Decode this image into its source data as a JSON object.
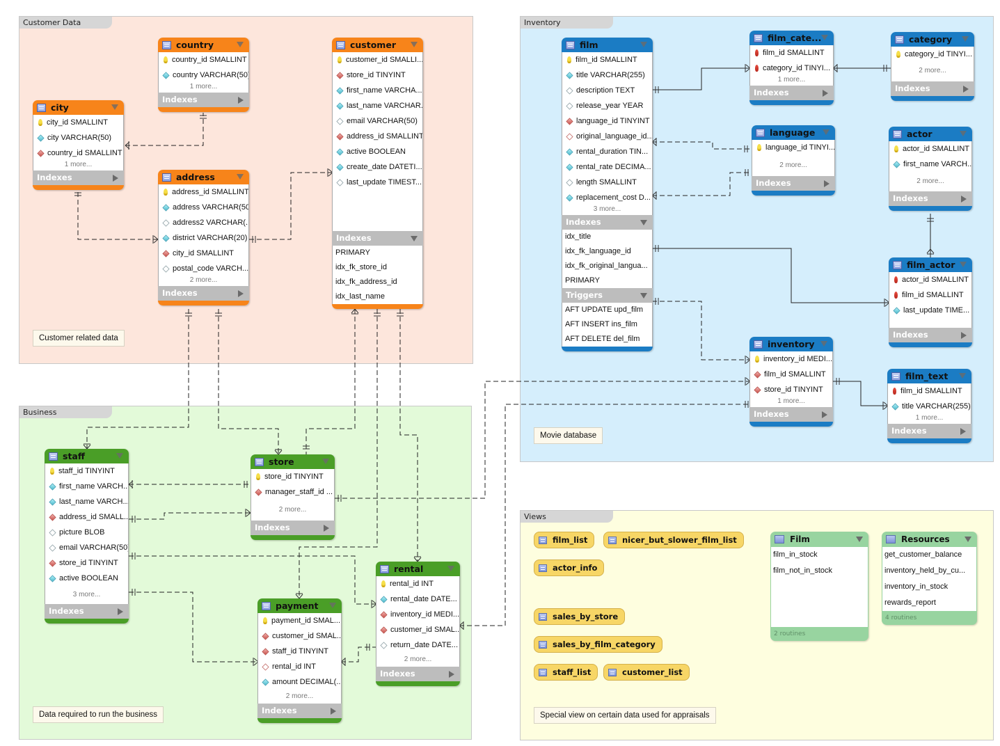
{
  "layers": {
    "customer_data": {
      "title": "Customer Data",
      "color": "#fde6dc",
      "note": "Customer related data"
    },
    "business": {
      "title": "Business",
      "color": "#e3fad9",
      "note": "Data required to run the business"
    },
    "inventory": {
      "title": "Inventory",
      "color": "#d5eefc",
      "note": "Movie database"
    },
    "views": {
      "title": "Views",
      "color": "#fefedf",
      "note": "Special view on certain data used for appraisals"
    }
  },
  "colors": {
    "customer_header": "#f7841a",
    "inventory_header": "#1b7cc4",
    "business_header": "#4a9e27",
    "view_chip": "#f7d666",
    "routine_group": "#98d4a0"
  },
  "section_labels": {
    "indexes": "Indexes",
    "triggers": "Triggers"
  },
  "tables": {
    "country": {
      "name": "country",
      "columns": [
        {
          "icon": "pk",
          "text": "country_id SMALLINT"
        },
        {
          "icon": "nn",
          "text": "country VARCHAR(50)"
        }
      ],
      "more": "1 more..."
    },
    "city": {
      "name": "city",
      "columns": [
        {
          "icon": "pk",
          "text": "city_id SMALLINT"
        },
        {
          "icon": "nn",
          "text": "city VARCHAR(50)"
        },
        {
          "icon": "fk",
          "text": "country_id SMALLINT"
        }
      ],
      "more": "1 more..."
    },
    "address": {
      "name": "address",
      "columns": [
        {
          "icon": "pk",
          "text": "address_id SMALLINT"
        },
        {
          "icon": "nn",
          "text": "address VARCHAR(50)"
        },
        {
          "icon": "plain",
          "text": "address2 VARCHAR(..."
        },
        {
          "icon": "nn",
          "text": "district VARCHAR(20)"
        },
        {
          "icon": "fk",
          "text": "city_id SMALLINT"
        },
        {
          "icon": "plain",
          "text": "postal_code VARCH..."
        }
      ],
      "more": "2 more..."
    },
    "customer": {
      "name": "customer",
      "columns": [
        {
          "icon": "pk",
          "text": "customer_id SMALLI..."
        },
        {
          "icon": "fk",
          "text": "store_id TINYINT"
        },
        {
          "icon": "nn",
          "text": "first_name VARCHA..."
        },
        {
          "icon": "nn",
          "text": "last_name VARCHAR..."
        },
        {
          "icon": "plain",
          "text": "email VARCHAR(50)"
        },
        {
          "icon": "fk",
          "text": "address_id SMALLINT"
        },
        {
          "icon": "nn",
          "text": "active BOOLEAN"
        },
        {
          "icon": "nn",
          "text": "create_date DATETI..."
        },
        {
          "icon": "plain",
          "text": "last_update TIMEST..."
        }
      ],
      "indexes": [
        "PRIMARY",
        "idx_fk_store_id",
        "idx_fk_address_id",
        "idx_last_name"
      ]
    },
    "film": {
      "name": "film",
      "columns": [
        {
          "icon": "pk",
          "text": "film_id SMALLINT"
        },
        {
          "icon": "nn",
          "text": "title VARCHAR(255)"
        },
        {
          "icon": "plain",
          "text": "description TEXT"
        },
        {
          "icon": "plain",
          "text": "release_year YEAR"
        },
        {
          "icon": "fk",
          "text": "language_id TINYINT"
        },
        {
          "icon": "fkplain",
          "text": "original_language_id..."
        },
        {
          "icon": "nn",
          "text": "rental_duration TIN..."
        },
        {
          "icon": "nn",
          "text": "rental_rate DECIMA..."
        },
        {
          "icon": "plain",
          "text": "length SMALLINT"
        },
        {
          "icon": "nn",
          "text": "replacement_cost D..."
        }
      ],
      "more": "3 more...",
      "indexes": [
        "idx_title",
        "idx_fk_language_id",
        "idx_fk_original_langua...",
        "PRIMARY"
      ],
      "triggers": [
        "AFT UPDATE upd_film",
        "AFT INSERT ins_film",
        "AFT DELETE del_film"
      ]
    },
    "film_category": {
      "name": "film_cate...",
      "columns": [
        {
          "icon": "pkfk",
          "text": "film_id SMALLINT"
        },
        {
          "icon": "pkfk",
          "text": "category_id TINYI..."
        }
      ],
      "more": "1 more..."
    },
    "category": {
      "name": "category",
      "columns": [
        {
          "icon": "pk",
          "text": "category_id TINYI..."
        }
      ],
      "more": "2 more..."
    },
    "language": {
      "name": "language",
      "columns": [
        {
          "icon": "pk",
          "text": "language_id TINYI..."
        }
      ],
      "more": "2 more..."
    },
    "actor": {
      "name": "actor",
      "columns": [
        {
          "icon": "pk",
          "text": "actor_id SMALLINT"
        },
        {
          "icon": "nn",
          "text": "first_name VARCH..."
        }
      ],
      "more": "2 more..."
    },
    "film_actor": {
      "name": "film_actor",
      "columns": [
        {
          "icon": "pkfk",
          "text": "actor_id SMALLINT"
        },
        {
          "icon": "pkfk",
          "text": "film_id SMALLINT"
        },
        {
          "icon": "nn",
          "text": "last_update TIME..."
        }
      ]
    },
    "inventory": {
      "name": "inventory",
      "columns": [
        {
          "icon": "pk",
          "text": "inventory_id MEDI..."
        },
        {
          "icon": "fk",
          "text": "film_id SMALLINT"
        },
        {
          "icon": "fk",
          "text": "store_id TINYINT"
        }
      ],
      "more": "1 more..."
    },
    "film_text": {
      "name": "film_text",
      "columns": [
        {
          "icon": "pkfk",
          "text": "film_id SMALLINT"
        },
        {
          "icon": "nn",
          "text": "title VARCHAR(255)"
        }
      ],
      "more": "1 more..."
    },
    "staff": {
      "name": "staff",
      "columns": [
        {
          "icon": "pk",
          "text": "staff_id TINYINT"
        },
        {
          "icon": "nn",
          "text": "first_name VARCH..."
        },
        {
          "icon": "nn",
          "text": "last_name VARCH..."
        },
        {
          "icon": "fk",
          "text": "address_id SMALL..."
        },
        {
          "icon": "plain",
          "text": "picture BLOB"
        },
        {
          "icon": "plain",
          "text": "email VARCHAR(50)"
        },
        {
          "icon": "fk",
          "text": "store_id TINYINT"
        },
        {
          "icon": "nn",
          "text": "active BOOLEAN"
        }
      ],
      "more": "3 more..."
    },
    "store": {
      "name": "store",
      "columns": [
        {
          "icon": "pk",
          "text": "store_id TINYINT"
        },
        {
          "icon": "fk",
          "text": "manager_staff_id ..."
        }
      ],
      "more": "2 more..."
    },
    "payment": {
      "name": "payment",
      "columns": [
        {
          "icon": "pk",
          "text": "payment_id SMAL..."
        },
        {
          "icon": "fk",
          "text": "customer_id SMAL..."
        },
        {
          "icon": "fk",
          "text": "staff_id TINYINT"
        },
        {
          "icon": "fkplain",
          "text": "rental_id INT"
        },
        {
          "icon": "nn",
          "text": "amount DECIMAL(..."
        }
      ],
      "more": "2 more..."
    },
    "rental": {
      "name": "rental",
      "columns": [
        {
          "icon": "pk",
          "text": "rental_id INT"
        },
        {
          "icon": "nn",
          "text": "rental_date DATE..."
        },
        {
          "icon": "fk",
          "text": "inventory_id MEDI..."
        },
        {
          "icon": "fk",
          "text": "customer_id SMAL..."
        },
        {
          "icon": "plain",
          "text": "return_date DATE..."
        }
      ],
      "more": "2 more..."
    }
  },
  "views": [
    "film_list",
    "nicer_but_slower_film_list",
    "actor_info",
    "sales_by_store",
    "sales_by_film_category",
    "staff_list",
    "customer_list"
  ],
  "routine_groups": {
    "film": {
      "name": "Film",
      "items": [
        "film_in_stock",
        "film_not_in_stock"
      ],
      "footer": "2 routines"
    },
    "resources": {
      "name": "Resources",
      "items": [
        "get_customer_balance",
        "inventory_held_by_cu...",
        "inventory_in_stock",
        "rewards_report"
      ],
      "footer": "4 routines"
    }
  }
}
